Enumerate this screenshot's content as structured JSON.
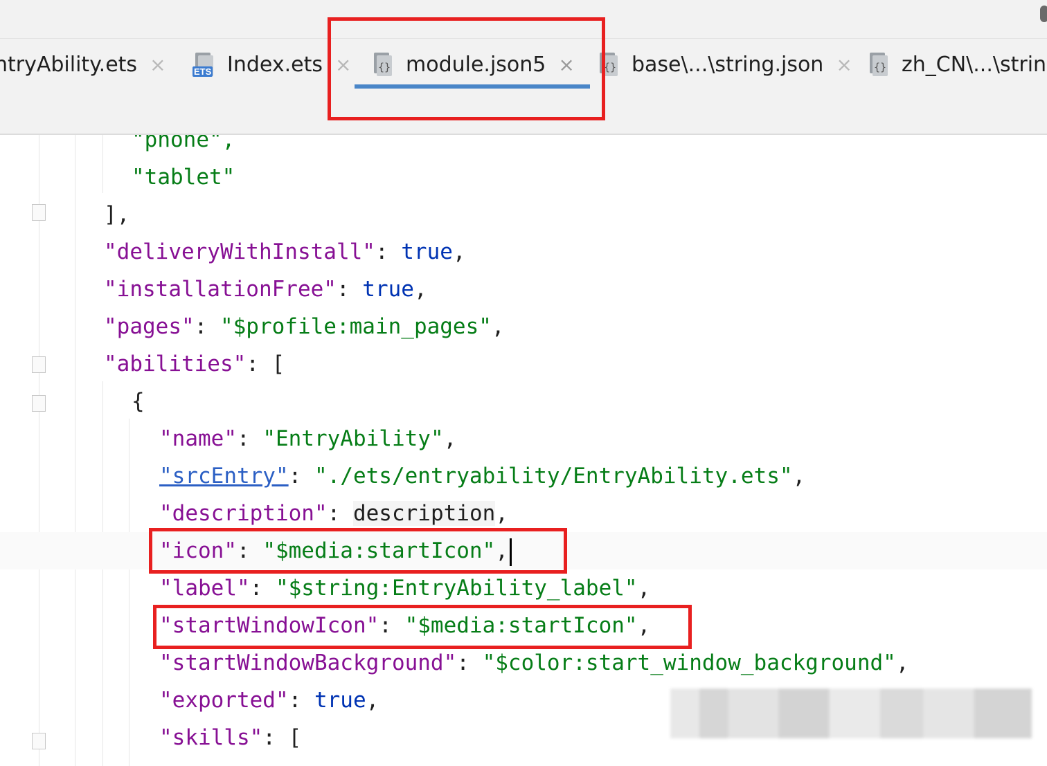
{
  "tabs": [
    {
      "label": "ntryAbility.ets",
      "icon": "file-icon",
      "active": false
    },
    {
      "label": "Index.ets",
      "icon": "ets-file-icon",
      "active": false
    },
    {
      "label": "module.json5",
      "icon": "json-file-icon",
      "active": true
    },
    {
      "label": "base\\...\\string.json",
      "icon": "json-file-icon",
      "active": false
    },
    {
      "label": "zh_CN\\...\\string",
      "icon": "json-file-icon",
      "active": false
    }
  ],
  "tab_close_glyph": "×",
  "code": {
    "l0": "\"phone\",",
    "l1": "\"tablet\"",
    "l2": "],",
    "l3_key": "\"deliveryWithInstall\"",
    "l3_val": "true",
    "l4_key": "\"installationFree\"",
    "l4_val": "true",
    "l5_key": "\"pages\"",
    "l5_val": "\"$profile:main_pages\"",
    "l6_key": "\"abilities\"",
    "l6_val": "[",
    "l7": "{",
    "l8_key": "\"name\"",
    "l8_val": "\"EntryAbility\"",
    "l9_key": "\"srcEntry\"",
    "l9_val": "\"./ets/entryability/EntryAbility.ets\"",
    "l10_key": "\"description\"",
    "l10_val": "description",
    "l11_key": "\"icon\"",
    "l11_val": "\"$media:startIcon\"",
    "l12_key": "\"label\"",
    "l12_val": "\"$string:EntryAbility_label\"",
    "l13_key": "\"startWindowIcon\"",
    "l13_val": "\"$media:startIcon\"",
    "l14_key": "\"startWindowBackground\"",
    "l14_val": "\"$color:start_window_background\"",
    "l15_key": "\"exported\"",
    "l15_val": "true",
    "l16_key": "\"skills\"",
    "l16_val": "["
  },
  "colors": {
    "key": "#871094",
    "string": "#067d17",
    "keyword": "#0033b3",
    "highlight_box": "#e82020",
    "active_tab_underline": "#4a86c8"
  }
}
